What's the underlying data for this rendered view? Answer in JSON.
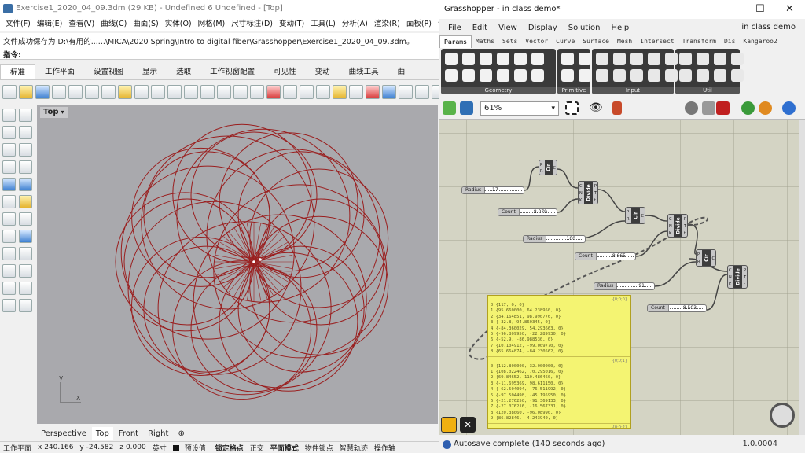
{
  "rhino": {
    "title": "Exercise1_2020_04_09.3dm (29 KB) - Undefined 6 Undefined - [Top]",
    "menu": [
      "文件(F)",
      "编辑(E)",
      "查看(V)",
      "曲线(C)",
      "曲面(S)",
      "实体(O)",
      "网格(M)",
      "尺寸标注(D)",
      "变动(T)",
      "工具(L)",
      "分析(A)",
      "渲染(R)",
      "面板(P)",
      "说"
    ],
    "command_history": "文件成功保存为 D:\\有用的......\\MICA\\2020 Spring\\Intro to digital fiber\\Grasshopper\\Exercise1_2020_04_09.3dm。",
    "command_prompt": "指令:",
    "toolbar_tabs": [
      "标准",
      "工作平面",
      "设置视图",
      "显示",
      "选取",
      "工作视窗配置",
      "可见性",
      "变动",
      "曲线工具",
      "曲"
    ],
    "viewport_label": "Top",
    "viewport_tabs": [
      "Perspective",
      "Top",
      "Front",
      "Right"
    ],
    "add_view_glyph": "⊕",
    "axis_y": "y",
    "axis_x": "x",
    "status": {
      "cplane": "工作平面",
      "x": "x 240.166",
      "y": "y -24.582",
      "z": "z 0.000",
      "unit": "英寸",
      "layer": "预设值",
      "toggles": [
        "锁定格点",
        "正交",
        "平面模式",
        "物件锁点",
        "智慧轨迹",
        "操作轴"
      ]
    },
    "curve_color": "#9a1e1e"
  },
  "grasshopper": {
    "title": "Grasshopper - in class demo*",
    "window_controls": [
      "—",
      "☐",
      "✕"
    ],
    "menu": [
      "File",
      "Edit",
      "View",
      "Display",
      "Solution",
      "Help"
    ],
    "doc_name": "in class demo",
    "tabs": [
      "Params",
      "Maths",
      "Sets",
      "Vector",
      "Curve",
      "Surface",
      "Mesh",
      "Intersect",
      "Transform",
      "Dis",
      "Kangaroo2"
    ],
    "ribbon_groups": [
      "Geometry",
      "Primitive",
      "Input",
      "Util"
    ],
    "zoom": "61%",
    "sliders": [
      {
        "name": "Radius",
        "value": "17"
      },
      {
        "name": "Count",
        "value": "8.079"
      },
      {
        "name": "Radius",
        "value": "100"
      },
      {
        "name": "Count",
        "value": "8.665"
      },
      {
        "name": "Radius",
        "value": "91"
      },
      {
        "name": "Count",
        "value": "8.503"
      }
    ],
    "components": [
      {
        "name": "Cir",
        "inputs": [
          "P",
          "R"
        ],
        "outputs": [
          "C"
        ]
      },
      {
        "name": "Divide",
        "inputs": [
          "C",
          "N",
          "K"
        ],
        "outputs": [
          "P",
          "T",
          "t"
        ]
      },
      {
        "name": "Cir",
        "inputs": [
          "P",
          "R"
        ],
        "outputs": [
          "C"
        ]
      },
      {
        "name": "Divide",
        "inputs": [
          "C",
          "N",
          "K"
        ],
        "outputs": [
          "P",
          "T",
          "t"
        ]
      },
      {
        "name": "Cir",
        "inputs": [
          "P",
          "R"
        ],
        "outputs": [
          "C"
        ]
      },
      {
        "name": "Divide",
        "inputs": [
          "C",
          "N",
          "K"
        ],
        "outputs": [
          "P",
          "T",
          "t"
        ]
      }
    ],
    "panel": {
      "header": "{0;0;0}",
      "lines_a": [
        "0 {117, 0, 0}",
        "1 {95.660000, 64.238950, 0}",
        "2 {34.164851, 98.990776, 0}",
        "3 {-32.8, 94.860345, 0}",
        "4 {-84.360029, 54.293663, 0}",
        "5 {-96.809950, -22.289930, 0}",
        "6 {-52.9, -86.988530, 0}",
        "7 {10.104912, -99.009770, 0}",
        "8 {65.664874, -84.230562, 0}"
      ],
      "sub_header": "{0;0;1}",
      "lines_b": [
        "0 {112.800000, 32.000000, 0}",
        "1 {108.022462, 70.295016, 0}",
        "2 {69.84652, 110.486460, 0}",
        "3 {-11.695369, 98.611150, 0}",
        "4 {-62.504094, -76.511992, 0}",
        "5 {-97.504498, -45.195950, 0}",
        "6 {-21.276250, -91.369133, 0}",
        "7 {-27.076216, -16.567331, 0}",
        "8 {120.38060, -96.08990, 0}",
        "9 {86.82846, -4.243940, 0}"
      ],
      "sub_header2": "{0;0;2}",
      "lines_c": [
        "0 {100, 0, 0}"
      ]
    },
    "status_message": "Autosave complete (140 seconds ago)",
    "version": "1.0.0004"
  }
}
